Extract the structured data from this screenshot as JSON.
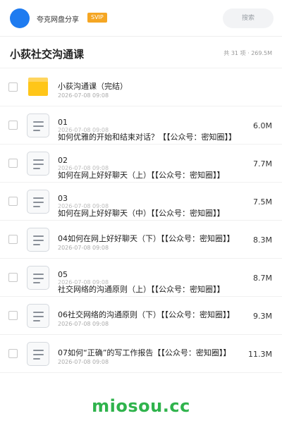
{
  "header": {
    "title": "夸克网盘分享",
    "badge": "SVIP",
    "search_placeholder": "搜索",
    "avatar_color": "#1e7bf0"
  },
  "folder": {
    "title": "小荻社交沟通课",
    "meta": "共 31 项 · 269.5M"
  },
  "files": [
    {
      "type": "folder",
      "name": "小荻沟通课（完结）",
      "date": "2026-07-08 09:08",
      "size": ""
    },
    {
      "type": "doc",
      "name_top": "01",
      "date": "2026-07-08 09:08",
      "name_bottom": "如何优雅的开始和结束对话？【【公众号：密知圈】】",
      "size": "6.0M"
    },
    {
      "type": "doc",
      "name_top": "02",
      "date": "2026-07-08 09:08",
      "name_bottom": "如何在网上好好聊天（上）【【公众号：密知圈】】",
      "size": "7.7M"
    },
    {
      "type": "doc",
      "name_top": "03",
      "date": "2026-07-08 09:08",
      "name_bottom": "如何在网上好好聊天（中）【【公众号：密知圈】】",
      "size": "7.5M"
    },
    {
      "type": "doc",
      "name": "04如何在网上好好聊天（下）【【公众号：密知圈】】",
      "date": "2026-07-08 09:08",
      "size": "8.3M"
    },
    {
      "type": "doc",
      "name_top": "05",
      "date": "2026-07-08 09:08",
      "name_bottom": "社交网络的沟通原则（上）【【公众号：密知圈】】",
      "size": "8.7M"
    },
    {
      "type": "doc",
      "name": "06社交网络的沟通原则（下）【【公众号：密知圈】】",
      "date": "2026-07-08 09:08",
      "size": "9.3M"
    },
    {
      "type": "doc",
      "name": "07如何“正确”的写工作报告【【公众号：密知圈】】",
      "date": "2026-07-08 09:08",
      "size": "11.3M"
    }
  ],
  "watermark": "miosou.cc",
  "colors": {
    "accent": "#1e7bf0",
    "svip": "#f5a623",
    "folder": "#ffc619",
    "watermark": "#2fb34c"
  }
}
